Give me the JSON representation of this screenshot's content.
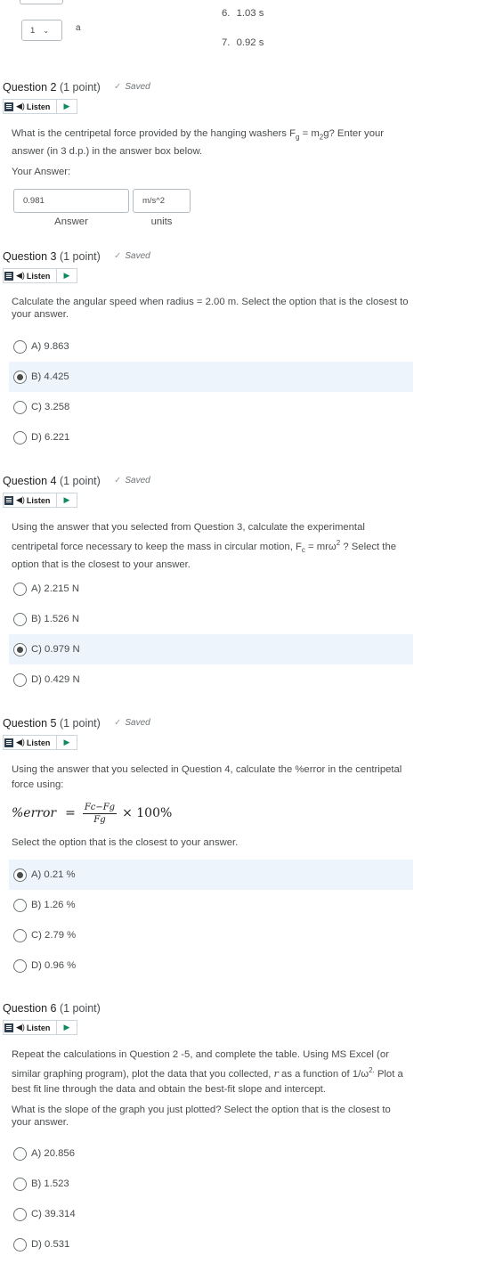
{
  "top": {
    "select_value": "1",
    "select_suffix": "a",
    "list": [
      {
        "num": "6.",
        "text": "1.03 s"
      },
      {
        "num": "7.",
        "text": "0.92 s"
      }
    ]
  },
  "listen_label": "Listen",
  "saved_label": "Saved",
  "q2": {
    "title": "Question 2",
    "points": "(1 point)",
    "text_a": "What is the centripetal force provided by the hanging washers F",
    "text_sub1": "g",
    "text_b": " = m",
    "text_sub2": "2",
    "text_c": "g? Enter your answer (in 3 d.p.) in the answer box below.",
    "your_answer": "Your Answer:",
    "answer_value": "0.981",
    "units_value": "m/s^2",
    "answer_caption": "Answer",
    "units_caption": "units"
  },
  "q3": {
    "title": "Question 3",
    "points": "(1 point)",
    "text": "Calculate the angular speed when radius = 2.00 m. Select the option that is the closest to your answer.",
    "options": [
      "A) 9.863",
      "B) 4.425",
      "C) 3.258",
      "D) 6.221"
    ],
    "selected": 1
  },
  "q4": {
    "title": "Question 4",
    "points": "(1 point)",
    "text_a": "Using the answer that you selected from Question 3, calculate the experimental centripetal force necessary to keep the mass in circular motion, F",
    "text_sub": "c",
    "text_b": " = mrω",
    "text_sup": "2",
    "text_c": " ? Select the option that is the closest to your answer.",
    "options": [
      "A) 2.215 N",
      "B) 1.526 N",
      "C) 0.979 N",
      "D) 0.429 N"
    ],
    "selected": 2
  },
  "q5": {
    "title": "Question 5",
    "points": "(1 point)",
    "text": "Using the answer that you selected in Question 4, calculate the %error in the centripetal force using:",
    "formula_lhs": "%error",
    "formula_eq": "=",
    "formula_num": "Fc−Fg",
    "formula_den": "Fg",
    "formula_rhs": "× 100%",
    "text2": "Select the option that is the closest to your answer.",
    "options": [
      "A) 0.21 %",
      "B) 1.26 %",
      "C) 2.79 %",
      "D) 0.96 %"
    ],
    "selected": 0
  },
  "q6": {
    "title": "Question 6",
    "points": "(1 point)",
    "text_a": "Repeat the calculations in Question 2 -5, and complete the table. Using MS Excel (or similar graphing program), plot the data that you collected, ",
    "text_r": "r",
    "text_b": " as a function of 1/ω",
    "text_sup": "2.",
    "text_c": " Plot a best fit line through the data and obtain the best-fit slope and intercept.",
    "text2": "What is the slope of the graph you just plotted? Select the option that is the closest to your answer.",
    "options": [
      "A) 20.856",
      "B) 1.523",
      "C) 39.314",
      "D) 0.531"
    ],
    "selected": -1
  }
}
